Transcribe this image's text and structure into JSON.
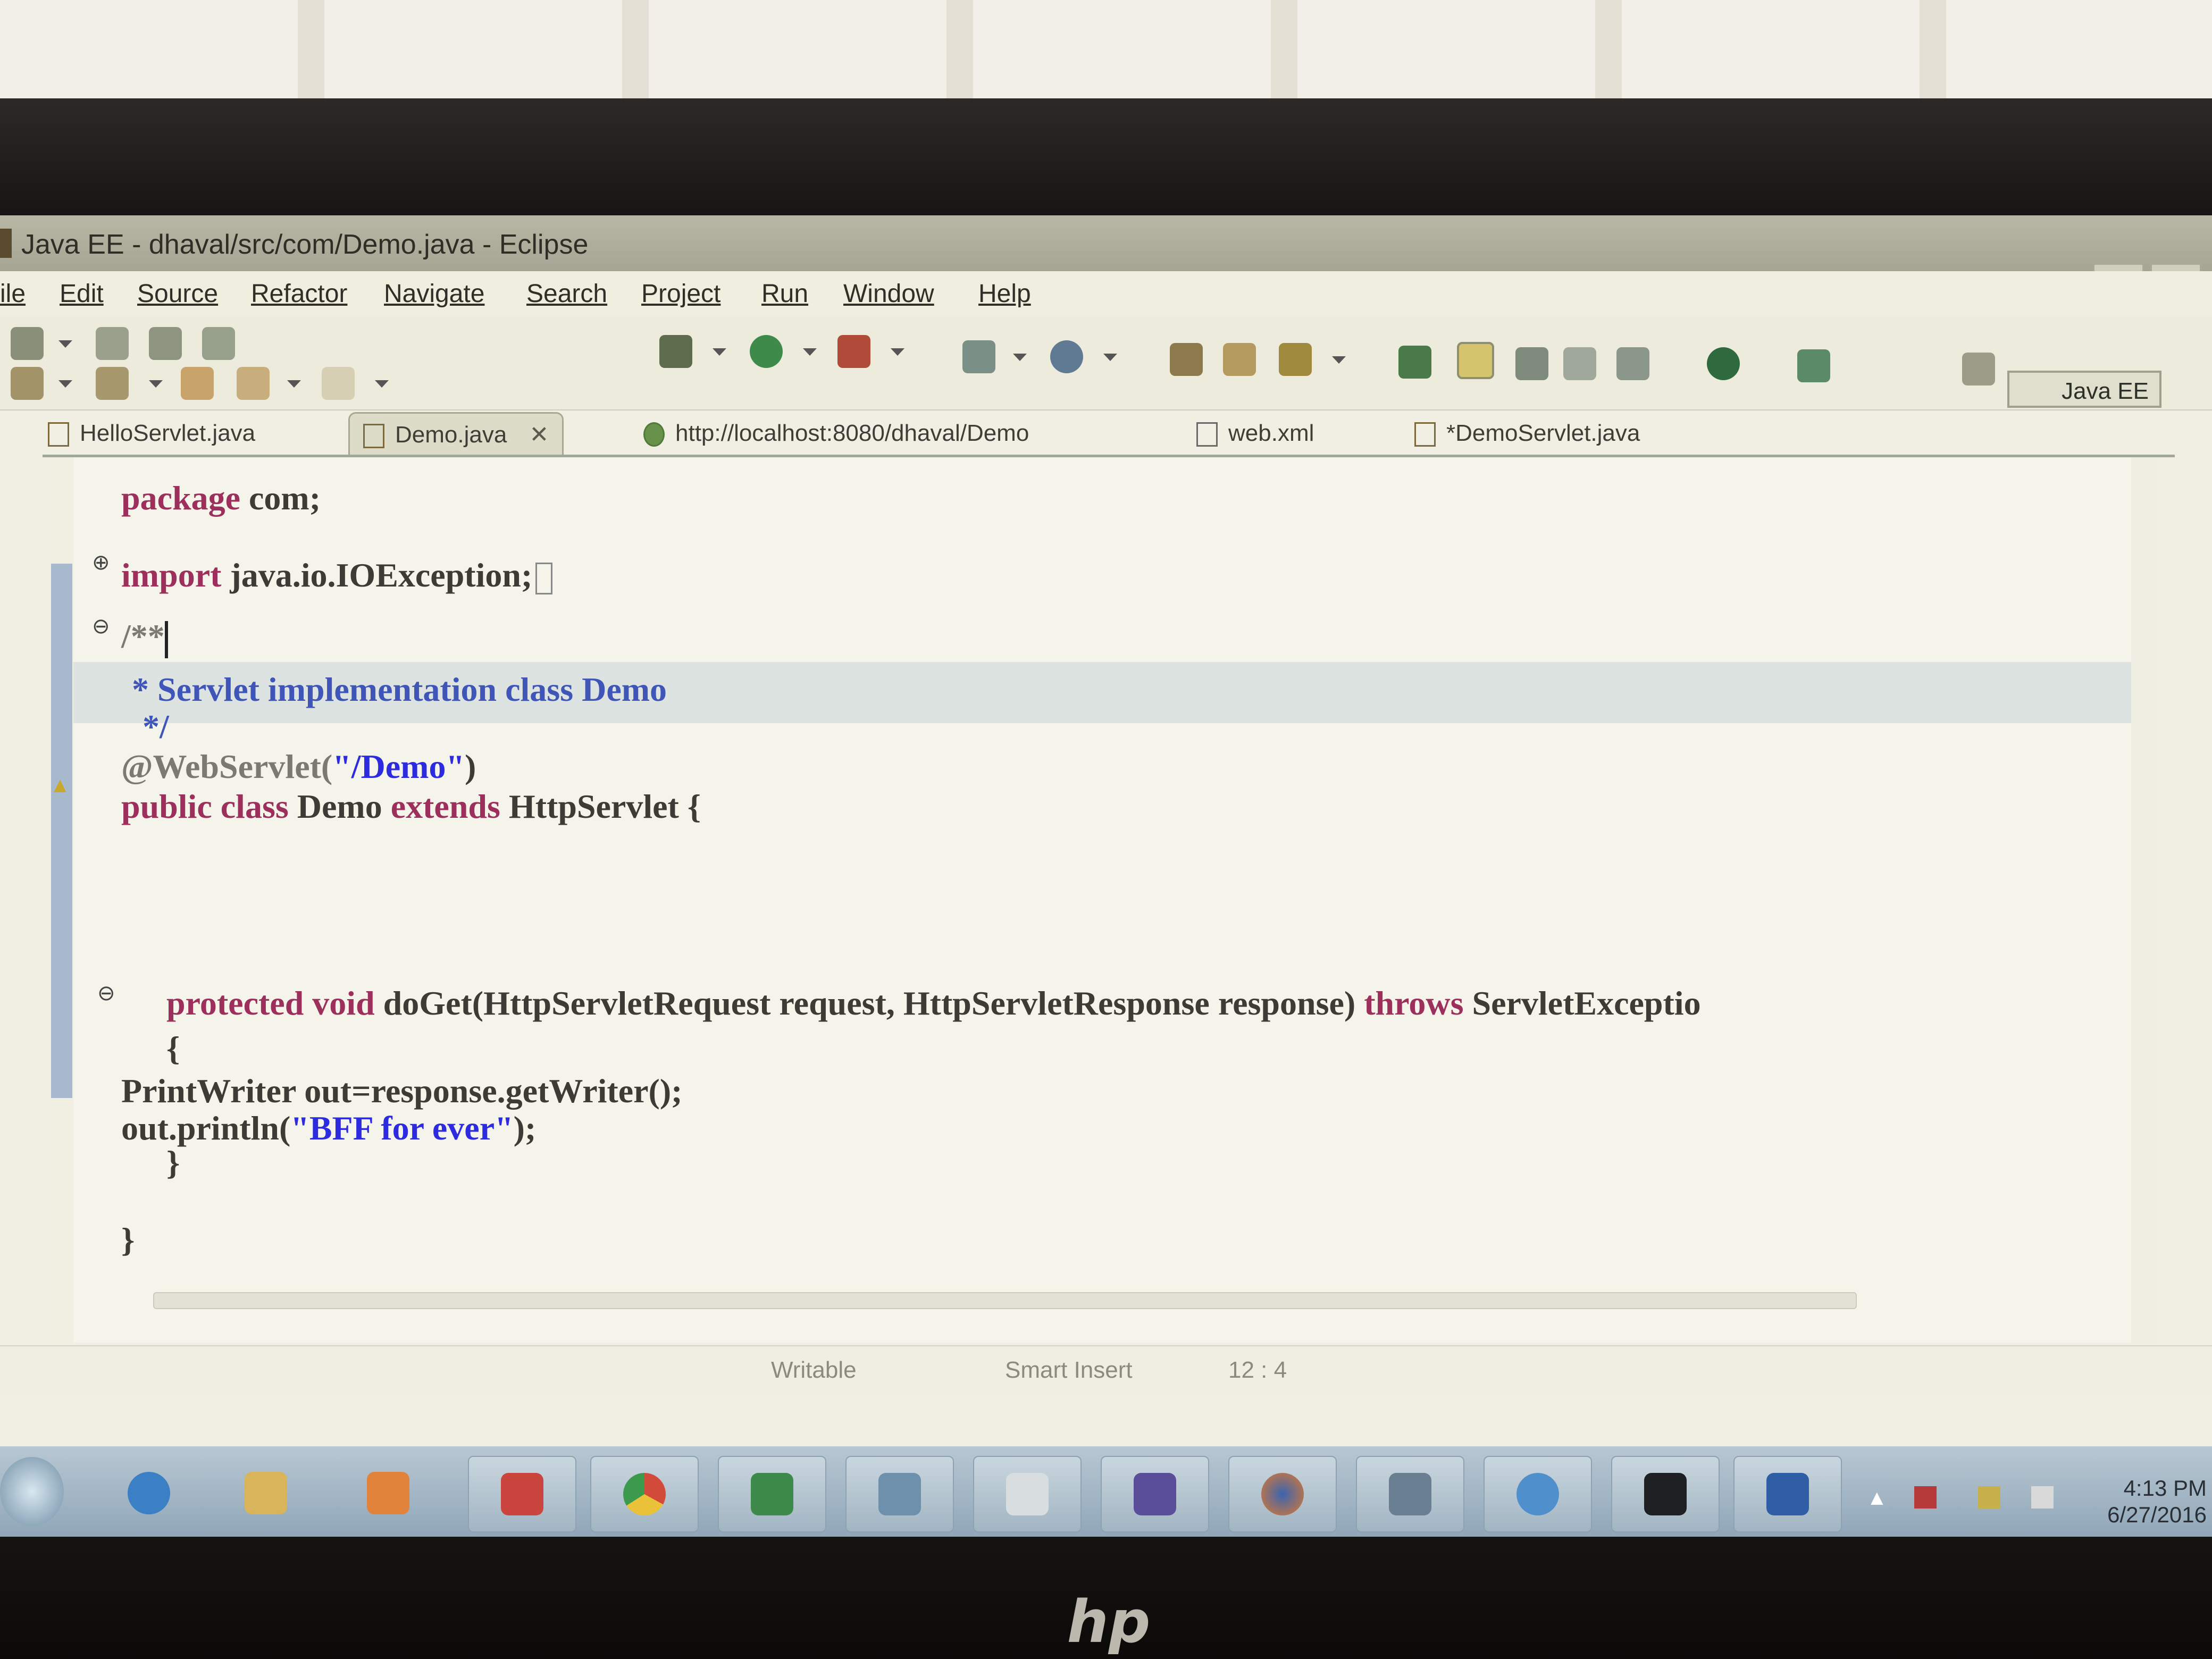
{
  "window": {
    "title": "Java EE - dhaval/src/com/Demo.java - Eclipse"
  },
  "menu": [
    "ile",
    "Edit",
    "Source",
    "Refactor",
    "Navigate",
    "Search",
    "Project",
    "Run",
    "Window",
    "Help"
  ],
  "toolbar": {
    "perspective_label": "Java EE"
  },
  "tabs": [
    {
      "label": "HelloServlet.java",
      "icon": "java-file-icon"
    },
    {
      "label": "Demo.java",
      "icon": "java-file-icon",
      "active": true,
      "close": "✕"
    },
    {
      "label": "http://localhost:8080/dhaval/Demo",
      "icon": "globe-icon"
    },
    {
      "label": "web.xml",
      "icon": "xml-file-icon"
    },
    {
      "label": "*DemoServlet.java",
      "icon": "java-file-icon"
    }
  ],
  "editor": {
    "lines": {
      "package_kw": "package",
      "package_name": "com;",
      "import_kw": "import",
      "import_name": "java.io.IOException;",
      "jdoc_open": "/**",
      "jdoc_star": "* ",
      "jdoc_text": "Servlet implementation class Demo",
      "jdoc_close": "*/",
      "annotation": "@WebServlet(",
      "annotation_str": "\"/Demo\"",
      "annotation_close": ")",
      "class_kw1": "public class ",
      "class_name": "Demo ",
      "class_kw2": "extends ",
      "class_rest": "HttpServlet {",
      "method_kw": "protected void ",
      "method_sig": "doGet(HttpServletRequest request, HttpServletResponse response) ",
      "method_throws": "throws ",
      "method_exc": "ServletExceptio",
      "brace_open": "{",
      "writer_line": "PrintWriter out=response.getWriter();",
      "println_start": "out.println(",
      "println_str": "\"BFF for ever\"",
      "println_end": ");",
      "brace_close_inner": "}",
      "brace_close_outer": "}"
    }
  },
  "status": {
    "writable": "Writable",
    "insert_mode": "Smart Insert",
    "position": "12 : 4"
  },
  "taskbar": {
    "apps": [
      "internet-explorer",
      "file-explorer",
      "media-player",
      "paint",
      "chrome",
      "excel",
      "photo-viewer",
      "notes",
      "control-panel",
      "firefox",
      "flash",
      "media-center",
      "command-prompt",
      "word"
    ],
    "clock_time": "4:13 PM",
    "clock_date": "6/27/2016"
  },
  "colors": {
    "keyword": "#9c2f5b",
    "string": "#2d2be0",
    "javadoc": "#3f55b8",
    "current_line": "#dde3e0"
  }
}
